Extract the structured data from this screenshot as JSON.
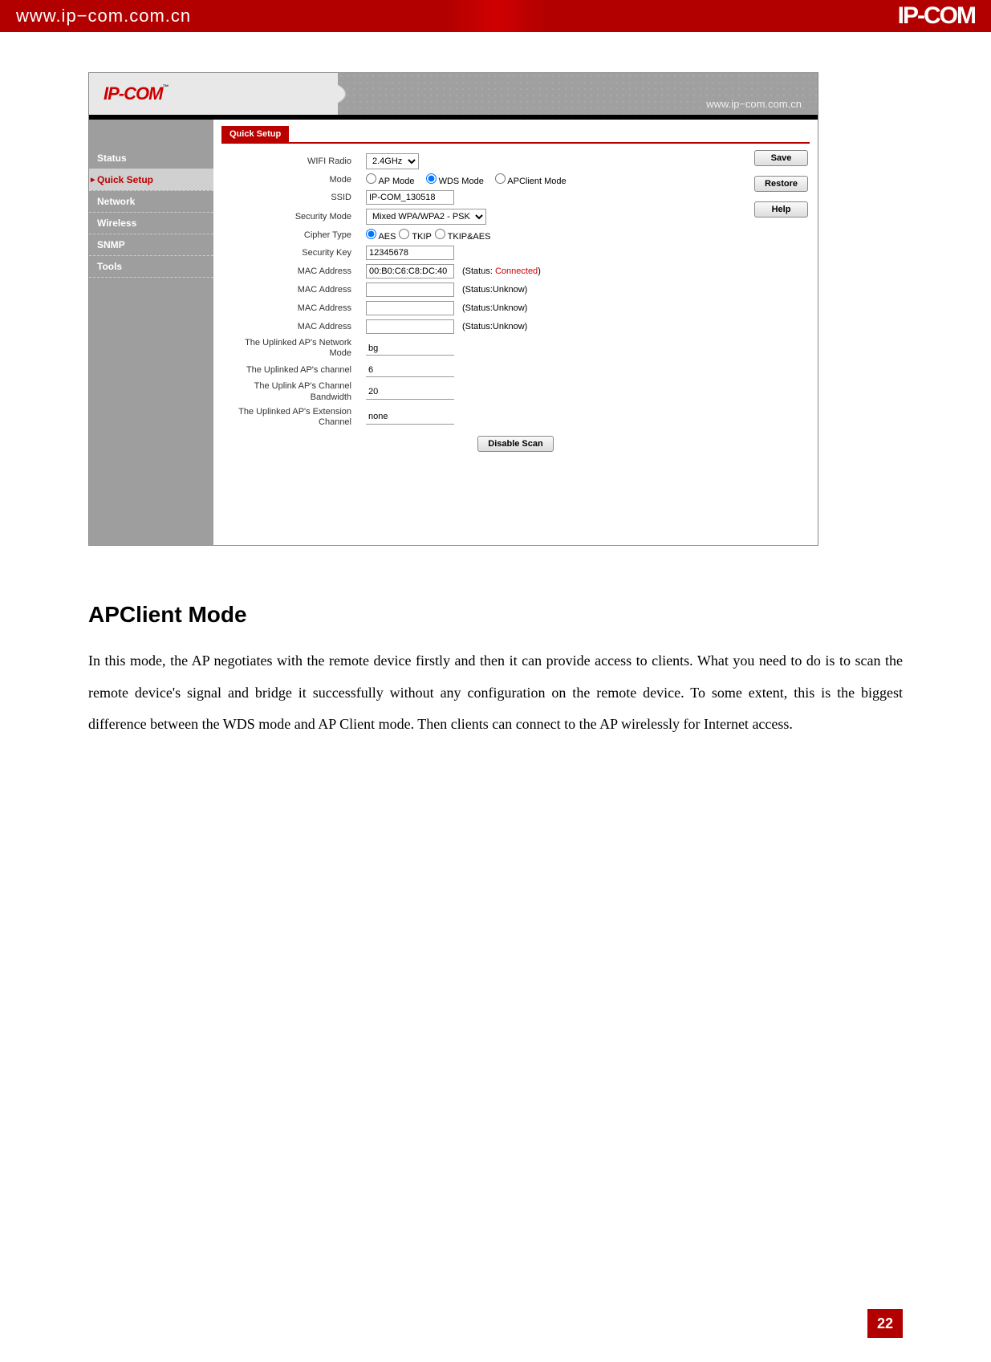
{
  "topBanner": {
    "url": "www.ip−com.com.cn",
    "logo": "IP-COM"
  },
  "screenshot": {
    "logo": "IP-COM",
    "headerUrl": "www.ip−com.com.cn",
    "sidebar": {
      "items": [
        {
          "label": "Status"
        },
        {
          "label": "Quick Setup",
          "active": true
        },
        {
          "label": "Network"
        },
        {
          "label": "Wireless"
        },
        {
          "label": "SNMP"
        },
        {
          "label": "Tools"
        }
      ]
    },
    "tab": "Quick Setup",
    "buttons": {
      "save": "Save",
      "restore": "Restore",
      "help": "Help",
      "disableScan": "Disable Scan"
    },
    "fields": {
      "wifiRadio": {
        "label": "WIFI Radio",
        "value": "2.4GHz"
      },
      "mode": {
        "label": "Mode",
        "options": [
          "AP Mode",
          "WDS Mode",
          "APClient Mode"
        ],
        "selected": "WDS Mode"
      },
      "ssid": {
        "label": "SSID",
        "value": "IP-COM_130518"
      },
      "securityMode": {
        "label": "Security Mode",
        "value": "Mixed WPA/WPA2 - PSK"
      },
      "cipherType": {
        "label": "Cipher Type",
        "options": [
          "AES",
          "TKIP",
          "TKIP&AES"
        ],
        "selected": "AES"
      },
      "securityKey": {
        "label": "Security Key",
        "value": "12345678"
      },
      "mac1": {
        "label": "MAC Address",
        "value": "00:B0:C6:C8:DC:40",
        "statusPrefix": "(Status: ",
        "statusValue": "Connected",
        "statusSuffix": ")"
      },
      "mac2": {
        "label": "MAC Address",
        "value": "",
        "status": "(Status:Unknow)"
      },
      "mac3": {
        "label": "MAC Address",
        "value": "",
        "status": "(Status:Unknow)"
      },
      "mac4": {
        "label": "MAC Address",
        "value": "",
        "status": "(Status:Unknow)"
      },
      "uplinkNetMode": {
        "label": "The Uplinked AP's Network Mode",
        "value": "bg"
      },
      "uplinkChannel": {
        "label": "The Uplinked AP's channel",
        "value": "6"
      },
      "uplinkBandwidth": {
        "label": "The Uplink AP's Channel Bandwidth",
        "value": "20"
      },
      "uplinkExtChannel": {
        "label": "The Uplinked AP's Extension Channel",
        "value": "none"
      }
    }
  },
  "doc": {
    "heading": "APClient Mode",
    "paragraph": "In this mode, the AP negotiates with the remote device firstly and then it can provide access to clients. What you need to do is to scan the remote device's signal and bridge it successfully without any configuration on the remote device. To some extent, this is the biggest difference between the WDS mode and AP Client mode. Then clients can connect to the AP wirelessly for Internet access."
  },
  "pageNumber": "22"
}
